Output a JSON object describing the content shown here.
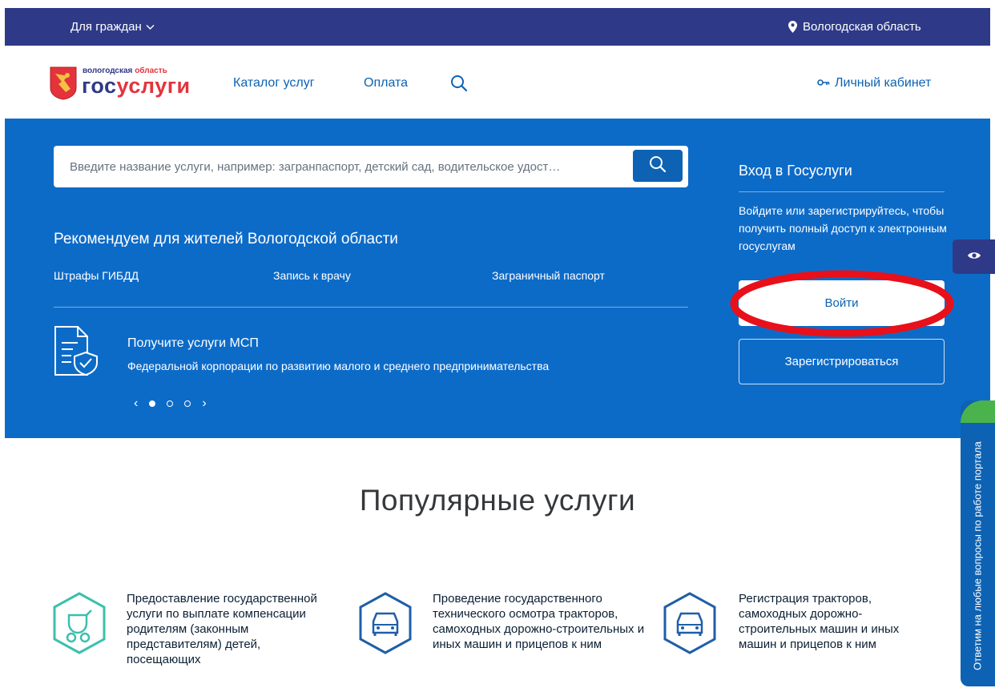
{
  "topbar": {
    "for_citizens": "Для граждан",
    "region": "Вологодская область"
  },
  "header": {
    "logo_region": [
      "вологодская",
      "область"
    ],
    "logo_brand": [
      "гос",
      "услуги"
    ],
    "nav": {
      "catalog": "Каталог услуг",
      "payment": "Оплата"
    },
    "cabinet": "Личный кабинет"
  },
  "hero": {
    "search_placeholder": "Введите название услуги, например: загранпаспорт, детский сад, водительское удост…",
    "recommend_title": "Рекомендуем для жителей Вологодской области",
    "recommend_links": [
      "Штрафы ГИБДД",
      "Запись к врачу",
      "Заграничный паспорт"
    ],
    "promo": {
      "title": "Получите услуги МСП",
      "subtitle": "Федеральной корпорации по развитию малого и среднего предпринимательства"
    },
    "carousel": {
      "prev": "‹",
      "next": "›"
    }
  },
  "login": {
    "title": "Вход в Госуслуги",
    "description": "Войдите или зарегистрируйтесь, чтобы получить полный доступ к электронным госуслугам",
    "login_button": "Войти",
    "register_button": "Зарегистрироваться"
  },
  "feedback": {
    "label": "Ответим на любые вопросы по работе портала"
  },
  "popular": {
    "title": "Популярные услуги",
    "services": [
      {
        "icon": "stroller-icon",
        "text": "Предоставление государственной услуги по выплате компенсации родителям (законным представителям) детей, посещающих"
      },
      {
        "icon": "car-icon",
        "text": "Проведение государственного технического осмотра тракторов, самоходных дорожно-строительных и иных машин и прицепов к ним"
      },
      {
        "icon": "car-icon",
        "text": "Регистрация тракторов, самоходных дорожно-строительных машин и иных машин и прицепов к ним"
      }
    ]
  },
  "colors": {
    "top_strip": "#2e3a87",
    "hero_blue": "#0d6bc8",
    "link_blue": "#0d62b3",
    "brand_red": "#e4333c",
    "annotation_red": "#e8101a",
    "teal_icon": "#3cbfae",
    "feedback_green": "#4bb34b"
  }
}
